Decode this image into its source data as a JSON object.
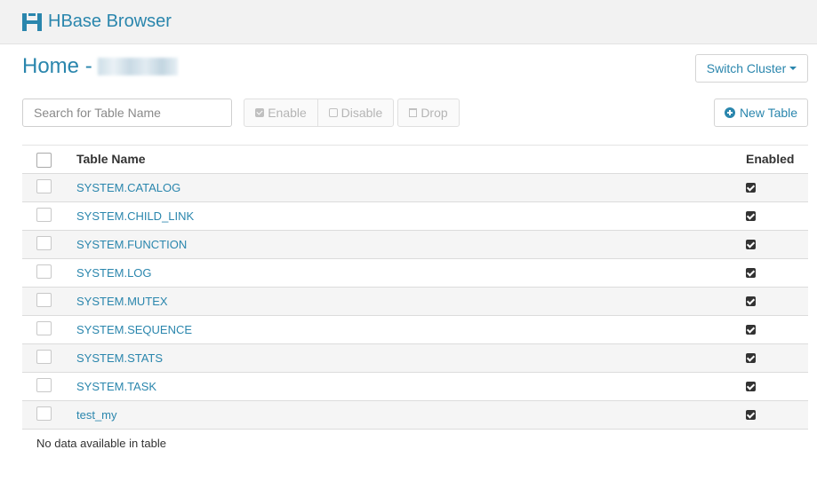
{
  "app": {
    "title": "HBase Browser"
  },
  "page": {
    "title": "Home -"
  },
  "header": {
    "switch_cluster_label": "Switch Cluster"
  },
  "toolbar": {
    "search_placeholder": "Search for Table Name",
    "enable_label": "Enable",
    "disable_label": "Disable",
    "drop_label": "Drop",
    "new_table_label": "New Table"
  },
  "table": {
    "columns": [
      "Table Name",
      "Enabled"
    ],
    "rows": [
      {
        "name": "SYSTEM.CATALOG",
        "enabled": true
      },
      {
        "name": "SYSTEM.CHILD_LINK",
        "enabled": true
      },
      {
        "name": "SYSTEM.FUNCTION",
        "enabled": true
      },
      {
        "name": "SYSTEM.LOG",
        "enabled": true
      },
      {
        "name": "SYSTEM.MUTEX",
        "enabled": true
      },
      {
        "name": "SYSTEM.SEQUENCE",
        "enabled": true
      },
      {
        "name": "SYSTEM.STATS",
        "enabled": true
      },
      {
        "name": "SYSTEM.TASK",
        "enabled": true
      },
      {
        "name": "test_my",
        "enabled": true
      }
    ],
    "footer": "No data available in table"
  },
  "colors": {
    "accent": "#2a86ad",
    "topbar": "#f2f2f2",
    "row_stripe": "#f5f5f5"
  },
  "icons": [
    "hbase-logo-icon",
    "caret-down-icon",
    "checkbox-checked-icon",
    "checkbox-empty-icon",
    "trash-icon",
    "plus-circle-icon"
  ]
}
